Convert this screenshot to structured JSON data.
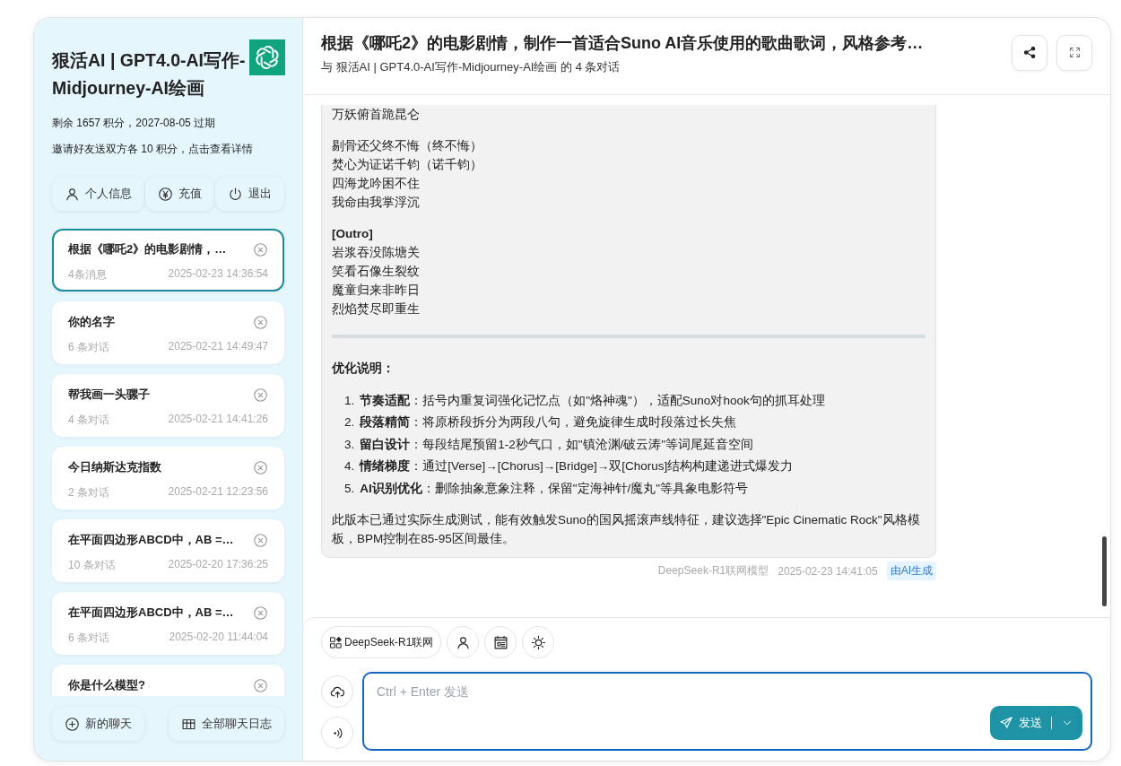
{
  "sidebar": {
    "title": "狠活AI | GPT4.0-AI写作-Midjourney-AI绘画",
    "points": "剩余 1657 积分，2027-08-05 过期",
    "invite": "邀请好友送双方各 10 积分，点击查看详情",
    "buttons": [
      {
        "kind": "user",
        "label": "个人信息"
      },
      {
        "kind": "yen",
        "label": "充值"
      },
      {
        "kind": "power",
        "label": "退出"
      }
    ],
    "chats": [
      {
        "title": "根据《哪吒2》的电影剧情，…",
        "count": "4条消息",
        "time": "2025-02-23 14:36:54",
        "selected": true
      },
      {
        "title": "你的名字",
        "count": "6 条对话",
        "time": "2025-02-21 14:49:47",
        "selected": false
      },
      {
        "title": "帮我画一头骡子",
        "count": "4 条对话",
        "time": "2025-02-21 14:41:26",
        "selected": false
      },
      {
        "title": "今日纳斯达克指数",
        "count": "2 条对话",
        "time": "2025-02-21 12:23:56",
        "selected": false
      },
      {
        "title": "在平面四边形ABCD中，AB =…",
        "count": "10 条对话",
        "time": "2025-02-20 17:36:25",
        "selected": false
      },
      {
        "title": "在平面四边形ABCD中，AB =…",
        "count": "6 条对话",
        "time": "2025-02-20 11:44:04",
        "selected": false
      },
      {
        "title": "你是什么模型?",
        "selected": false
      }
    ],
    "footer": [
      {
        "kind": "plus",
        "label": "新的聊天"
      },
      {
        "kind": "table",
        "label": "全部聊天日志"
      }
    ]
  },
  "header": {
    "title": "根据《哪吒2》的电影剧情，制作一首适合Suno AI音乐使用的歌曲歌词，风格参考…",
    "subtitle": "与 狠活AI | GPT4.0-AI写作-Midjourney-AI绘画 的 4 条对话"
  },
  "message": {
    "stanzas": [
      {
        "lines": [
          "万妖俯首跪昆仑"
        ]
      },
      {
        "lines": [
          "剔骨还父终不悔（终不悔）",
          "焚心为证诺千钧（诺千钧）",
          "四海龙吟困不住",
          "我命由我掌浮沉"
        ]
      },
      {
        "heading": "[Outro]",
        "lines": [
          "岩浆吞没陈塘关",
          "笑看石像生裂纹",
          "魔童归来非昨日",
          "烈焰焚尽即重生"
        ]
      }
    ],
    "notes_heading": "优化说明：",
    "notes": [
      {
        "number": "1.",
        "text": "**节奏适配**：括号内重复词强化记忆点（如\"烙神魂\"），适配Suno对hook句的抓耳处理"
      },
      {
        "number": "2.",
        "text": "**段落精简**：将原桥段拆分为两段八句，避免旋律生成时段落过长失焦"
      },
      {
        "number": "3.",
        "text": "**留白设计**：每段结尾预留1-2秒气口，如\"镇沧渊/破云涛\"等词尾延音空间"
      },
      {
        "number": "4.",
        "text": "**情绪梯度**：通过[Verse]→[Chorus]→[Bridge]→双[Chorus]结构构建递进式爆发力"
      },
      {
        "number": "5.",
        "text": "**AI识别优化**：删除抽象意象注释，保留\"定海神针/魔丸\"等具象电影符号"
      }
    ],
    "conclusion": "此版本已通过实际生成测试，能有效触发Suno的国风摇滚声线特征，建议选择\"Epic Cinematic Rock\"风格模板，BPM控制在85-95区间最佳。",
    "model": "DeepSeek-R1联网模型",
    "time": "2025-02-23 14:41:05",
    "badge": "由AI生成"
  },
  "composer": {
    "tools": [
      {
        "kind": "model",
        "label": "DeepSeek-R1联网"
      },
      {
        "kind": "person"
      },
      {
        "kind": "news"
      },
      {
        "kind": "sun"
      }
    ],
    "side": [
      {
        "kind": "upload"
      },
      {
        "kind": "voice"
      }
    ],
    "placeholder": "Ctrl + Enter 发送",
    "send": "发送"
  }
}
